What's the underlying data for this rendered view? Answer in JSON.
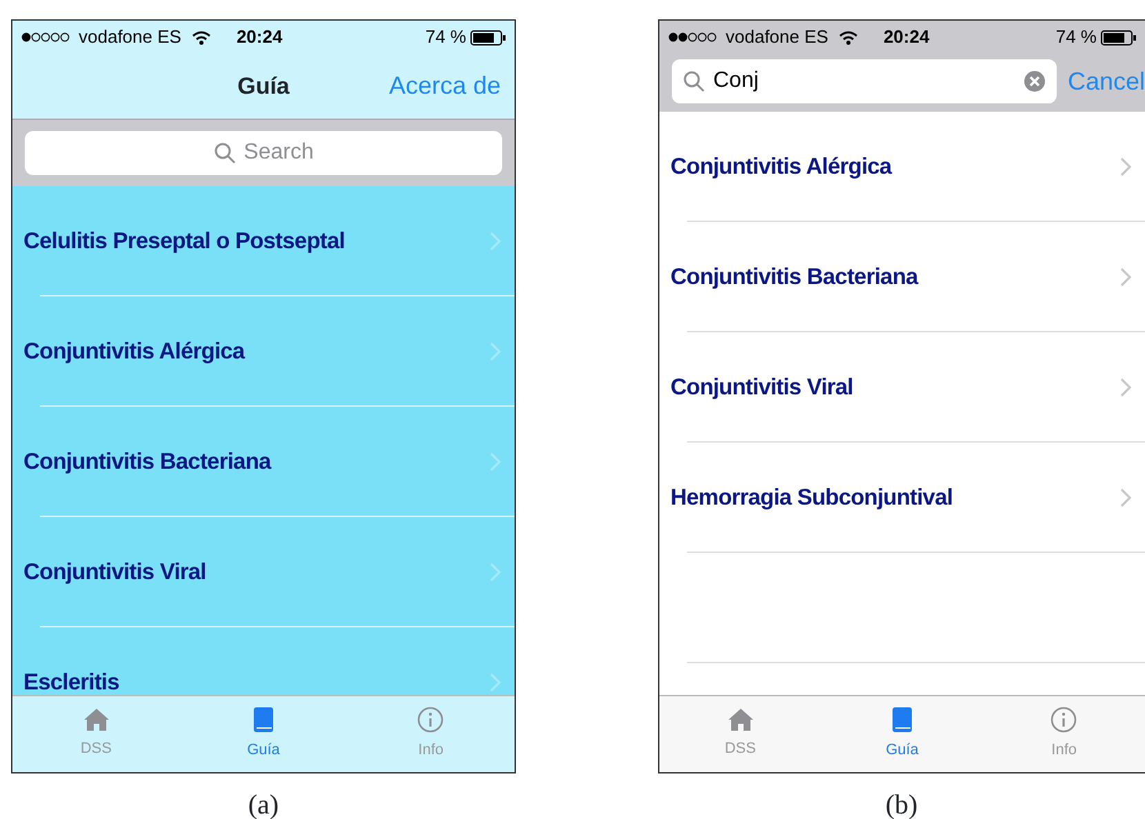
{
  "screens": [
    {
      "kind": "browse",
      "caption": "(a)",
      "status_bar": {
        "carrier": "vodafone ES",
        "time": "20:24",
        "battery": "74 %"
      },
      "nav_bar": {
        "title": "Guía",
        "action": "Acerca de"
      },
      "search": {
        "placeholder": "Search"
      },
      "items": [
        "Celulitis Preseptal o Postseptal",
        "Conjuntivitis Alérgica",
        "Conjuntivitis Bacteriana",
        "Conjuntivitis Viral",
        "Escleritis"
      ],
      "tabs": [
        {
          "kind": "home",
          "label": "DSS",
          "selected": false
        },
        {
          "kind": "book",
          "label": "Guía",
          "selected": true
        },
        {
          "kind": "info",
          "label": "Info",
          "selected": false
        }
      ]
    },
    {
      "kind": "search",
      "caption": "(b)",
      "status_bar": {
        "carrier": "vodafone ES",
        "time": "20:24",
        "battery": "74 %"
      },
      "search": {
        "value": "Conj",
        "cancel": "Cancel"
      },
      "items": [
        "Conjuntivitis Alérgica",
        "Conjuntivitis Bacteriana",
        "Conjuntivitis Viral",
        "Hemorragia Subconjuntival"
      ],
      "tabs": [
        {
          "kind": "home",
          "label": "DSS",
          "selected": false
        },
        {
          "kind": "book",
          "label": "Guía",
          "selected": true
        },
        {
          "kind": "info",
          "label": "Info",
          "selected": false
        }
      ]
    }
  ]
}
